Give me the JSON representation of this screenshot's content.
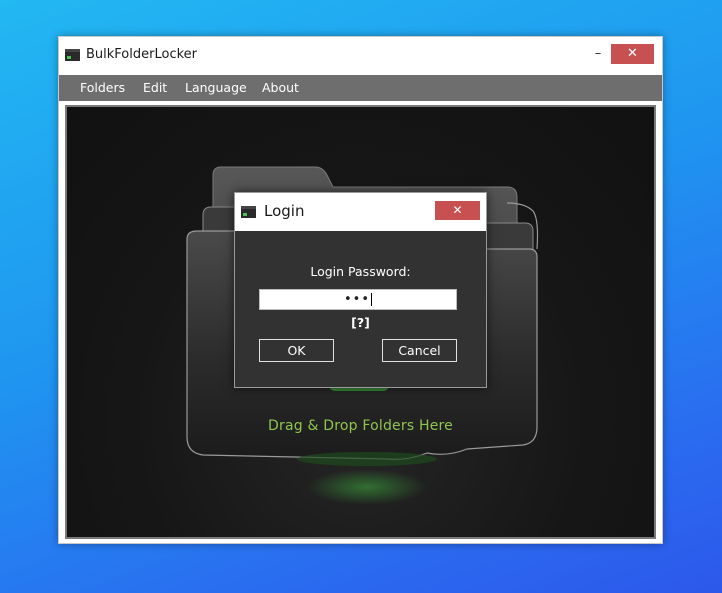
{
  "window": {
    "title": "BulkFolderLocker",
    "minimize_glyph": "–",
    "close_glyph": "✕"
  },
  "menu": {
    "items": [
      "Folders",
      "Edit",
      "Language",
      "About"
    ]
  },
  "content": {
    "drop_text": "Drag & Drop Folders Here"
  },
  "dialog": {
    "title": "Login",
    "close_glyph": "✕",
    "password_label": "Login Password:",
    "password_value": "•••",
    "help_text": "[?]",
    "ok_label": "OK",
    "cancel_label": "Cancel"
  },
  "colors": {
    "desktop_accent": "#1f95f0",
    "close_button": "#c75050",
    "menubar": "#6e6e6e",
    "drop_text": "#8fc54f",
    "dialog_body": "#323232"
  },
  "icons": {
    "app": "app-window-icon",
    "illustration": "folder-icon"
  }
}
